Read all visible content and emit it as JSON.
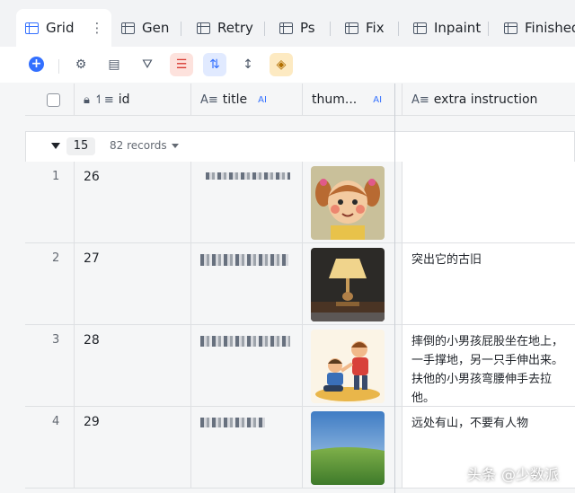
{
  "tabs": [
    {
      "label": "Grid",
      "active": true
    },
    {
      "label": "Gen"
    },
    {
      "label": "Retry"
    },
    {
      "label": "Ps"
    },
    {
      "label": "Fix"
    },
    {
      "label": "Inpaint"
    },
    {
      "label": "Finished"
    }
  ],
  "tab_more": "⋮",
  "columns": {
    "id": "id",
    "title": "title",
    "title_ai": "AI",
    "thumb": "thum...",
    "thumb_ai": "AI",
    "extra": "extra instruction"
  },
  "group": {
    "count": "15",
    "records": "82 records"
  },
  "rows": [
    {
      "num": "1",
      "id": "26",
      "extra": ""
    },
    {
      "num": "2",
      "id": "27",
      "extra": "突出它的古旧"
    },
    {
      "num": "3",
      "id": "28",
      "extra": "摔倒的小男孩屁股坐在地上，一手撑地，另一只手伸出来。扶他的小男孩弯腰伸手去拉他。"
    },
    {
      "num": "4",
      "id": "29",
      "extra": "远处有山，不要有人物"
    }
  ],
  "watermark": {
    "prefix": "头条",
    "handle": "@少数派"
  },
  "colors": {
    "accent": "#3370ff",
    "header_bg": "#f5f6f7",
    "tabbar_bg": "#f2f3f5"
  }
}
